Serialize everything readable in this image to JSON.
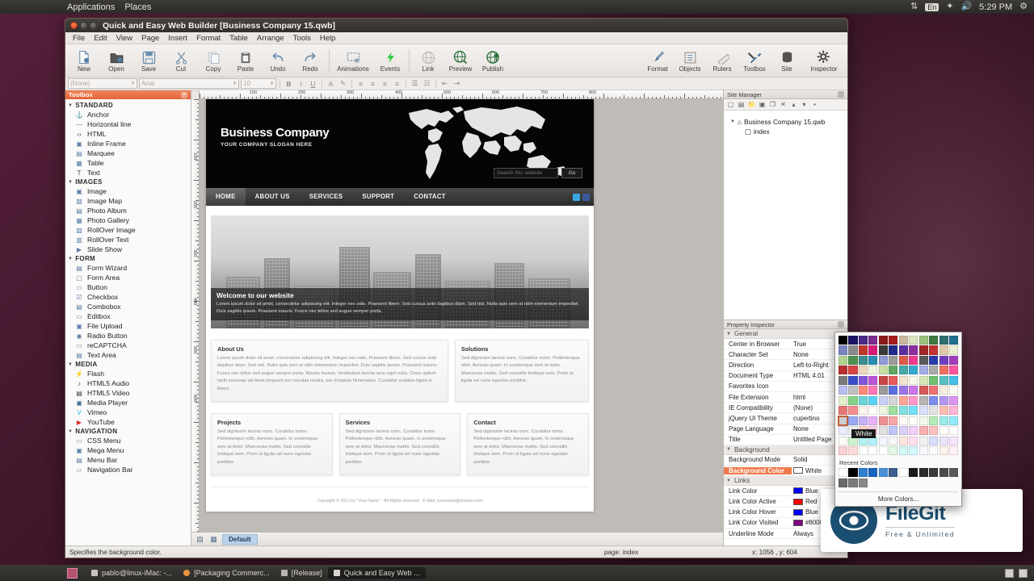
{
  "desktop": {
    "top_panel": {
      "menus": [
        "Applications",
        "Places"
      ],
      "clock": "5:29 PM",
      "indicators": [
        "network-icon",
        "keyboard-layout-en",
        "bluetooth-icon",
        "volume-icon",
        "system-settings-icon"
      ],
      "keyboard_layout": "En"
    },
    "taskbar": {
      "items": [
        {
          "label": "pablo@linux-iMac: -...",
          "color": "#c9c4be",
          "active": false
        },
        {
          "label": "[Packaging Commerc...",
          "color": "#e8953f",
          "active": false
        },
        {
          "label": "[Release]",
          "color": "#b8b3ad",
          "active": false
        },
        {
          "label": "Quick and Easy Web ...",
          "color": "#d8d3cd",
          "active": true
        }
      ]
    },
    "watermark": {
      "name": "FileGit",
      "tagline": "Free & Unlimited"
    }
  },
  "window": {
    "title": "Quick and Easy Web Builder [Business Company 15.qwb]",
    "menu": [
      "File",
      "Edit",
      "View",
      "Page",
      "Insert",
      "Format",
      "Table",
      "Arrange",
      "Tools",
      "Help"
    ]
  },
  "toolbar": {
    "left_buttons": [
      {
        "label": "New",
        "icon": "new-document-icon"
      },
      {
        "label": "Open",
        "icon": "open-folder-icon"
      },
      {
        "label": "Save",
        "icon": "floppy-disk-icon"
      },
      {
        "label": "Cut",
        "icon": "scissors-icon"
      },
      {
        "label": "Copy",
        "icon": "copy-icon"
      },
      {
        "label": "Paste",
        "icon": "clipboard-icon"
      },
      {
        "label": "Undo",
        "icon": "undo-arrow-icon"
      },
      {
        "label": "Redo",
        "icon": "redo-arrow-icon"
      },
      {
        "label": "Animations",
        "icon": "animation-icon"
      },
      {
        "label": "Events",
        "icon": "lightning-bolt-icon"
      },
      {
        "label": "Link",
        "icon": "globe-link-icon"
      },
      {
        "label": "Preview",
        "icon": "globe-search-icon"
      },
      {
        "label": "Publish",
        "icon": "globe-upload-icon"
      }
    ],
    "right_buttons": [
      {
        "label": "Format",
        "icon": "paintbrush-icon"
      },
      {
        "label": "Objects",
        "icon": "list-objects-icon"
      },
      {
        "label": "Rulers",
        "icon": "ruler-icon"
      },
      {
        "label": "Toolbox",
        "icon": "wrench-screwdriver-icon"
      },
      {
        "label": "Site",
        "icon": "database-icon"
      },
      {
        "label": "Inspector",
        "icon": "gear-icon"
      }
    ]
  },
  "fontbar": {
    "style_value": "(None)",
    "font_value": "Arial",
    "size_value": "10",
    "buttons": [
      "B",
      "I",
      "U"
    ]
  },
  "toolbox": {
    "caption": "Toolbox",
    "groups": [
      {
        "name": "STANDARD",
        "items": [
          {
            "label": "Anchor",
            "icon": "anchor-icon"
          },
          {
            "label": "Horizontal line",
            "icon": "horizontal-line-icon"
          },
          {
            "label": "HTML",
            "icon": "code-brackets-icon"
          },
          {
            "label": "Inline Frame",
            "icon": "inline-frame-icon"
          },
          {
            "label": "Marquee",
            "icon": "marquee-icon"
          },
          {
            "label": "Table",
            "icon": "table-icon"
          },
          {
            "label": "Text",
            "icon": "text-tool-icon"
          }
        ]
      },
      {
        "name": "IMAGES",
        "items": [
          {
            "label": "Image",
            "icon": "image-icon"
          },
          {
            "label": "Image Map",
            "icon": "image-map-icon"
          },
          {
            "label": "Photo Album",
            "icon": "photo-album-icon"
          },
          {
            "label": "Photo Gallery",
            "icon": "photo-gallery-icon"
          },
          {
            "label": "RollOver Image",
            "icon": "rollover-image-icon"
          },
          {
            "label": "RollOver Text",
            "icon": "rollover-text-icon"
          },
          {
            "label": "Slide Show",
            "icon": "slideshow-icon"
          }
        ]
      },
      {
        "name": "FORM",
        "items": [
          {
            "label": "Form Wizard",
            "icon": "form-wizard-icon"
          },
          {
            "label": "Form Area",
            "icon": "form-area-icon"
          },
          {
            "label": "Button",
            "icon": "button-icon"
          },
          {
            "label": "Checkbox",
            "icon": "checkbox-icon"
          },
          {
            "label": "Combobox",
            "icon": "combobox-icon"
          },
          {
            "label": "Editbox",
            "icon": "editbox-icon"
          },
          {
            "label": "File Upload",
            "icon": "file-upload-icon"
          },
          {
            "label": "Radio Button",
            "icon": "radio-button-icon"
          },
          {
            "label": "reCAPTCHA",
            "icon": "recaptcha-icon"
          },
          {
            "label": "Text Area",
            "icon": "textarea-icon"
          }
        ]
      },
      {
        "name": "MEDIA",
        "items": [
          {
            "label": "Flash",
            "icon": "flash-icon"
          },
          {
            "label": "HTML5 Audio",
            "icon": "audio-note-icon"
          },
          {
            "label": "HTML5 Video",
            "icon": "video-icon"
          },
          {
            "label": "Media Player",
            "icon": "media-player-icon"
          },
          {
            "label": "Vimeo",
            "icon": "vimeo-icon"
          },
          {
            "label": "YouTube",
            "icon": "youtube-icon"
          }
        ]
      },
      {
        "name": "NAVIGATION",
        "items": [
          {
            "label": "CSS Menu",
            "icon": "css-menu-icon"
          },
          {
            "label": "Mega Menu",
            "icon": "mega-menu-icon"
          },
          {
            "label": "Menu Bar",
            "icon": "menu-bar-icon"
          },
          {
            "label": "Navigation Bar",
            "icon": "navigation-bar-icon"
          }
        ]
      }
    ]
  },
  "ruler": {
    "h_labels": [
      "100",
      "200",
      "300",
      "400",
      "500",
      "600",
      "700",
      "800"
    ],
    "v_labels": [
      "100",
      "200",
      "300",
      "400",
      "500",
      "600"
    ]
  },
  "site_page": {
    "brand": "Business Company",
    "slogan": "YOUR COMPANY SLOGAN HERE",
    "search_placeholder": "Search this website",
    "search_button": "Go",
    "nav": [
      "HOME",
      "ABOUT US",
      "SERVICES",
      "SUPPORT",
      "CONTACT"
    ],
    "hero": {
      "title": "Welcome to our website",
      "text": "Lorem ipsum dolor sit amet, consectetur adipiscing elit. Integer nec odio. Praesent libero. Sed cursus ante dapibus diam. Sed nisi. Nulla quis sem at nibh elementum imperdiet. Duis sagittis ipsum. Praesent mauris. Fusce nec tellus sed augue semper porta."
    },
    "columns_top": [
      {
        "title": "About Us",
        "text": "Lorem ipsum dolor sit amet, consectetur adipiscing elit. Integer nec odio. Praesent libero. Sed cursus ante dapibus diam. Sed nisi. Nulla quis sem at nibh elementum imperdiet. Duis sagittis ipsum. Praesent mauris. Fusce nec tellus sed augue semper porta. Mauris massa. Vestibulum lacinia arcu eget nulla. Class aptent taciti sociosqu ad litora torquent per conubia nostra, per inceptos himenaeos. Curabitur sodales ligula in libero."
      },
      {
        "title": "Solutions",
        "text": "Sed dignissim lacinia nunc. Curabitur tortor. Pellentesque nibh. Aenean quam. In scelerisque sem at dolor. Maecenas mattis. Sed convallis tristique sem. Proin ut ligula vel nunc egestas porttitor."
      }
    ],
    "columns_bottom": [
      {
        "title": "Projects",
        "text": "Sed dignissim lacinia nunc. Curabitur tortor. Pellentesque nibh. Aenean quam. In scelerisque sem at dolor. Maecenas mattis. Sed convallis tristique sem. Proin ut ligula vel nunc egestas porttitor."
      },
      {
        "title": "Services",
        "text": "Sed dignissim lacinia nunc. Curabitur tortor. Pellentesque nibh. Aenean quam. In scelerisque sem at dolor. Maecenas mattis. Sed convallis tristique sem. Proin ut ligula vel nunc egestas porttitor."
      },
      {
        "title": "Contact",
        "text": "Sed dignissim lacinia nunc. Curabitur tortor. Pellentesque nibh. Aenean quam. In scelerisque sem at dolor. Maecenas mattis. Sed convallis tristique sem. Proin ut ligula vel nunc egestas porttitor."
      }
    ],
    "footer": "Copyright © 2013 by \"Your Name\"  -  All Rights reserved  -  E-Mail: yourname@domain.com"
  },
  "canvas_bar": {
    "tab_label": "Default"
  },
  "site_manager": {
    "caption": "Site Manager",
    "root": "Business Company 15.qwb",
    "child": "index"
  },
  "property_inspector": {
    "caption": "Property Inspector",
    "groups": [
      {
        "name": "General",
        "rows": [
          {
            "key": "Center in Browser",
            "value": "True"
          },
          {
            "key": "Character Set",
            "value": "None"
          },
          {
            "key": "Direction",
            "value": "Left-to-Right"
          },
          {
            "key": "Document Type",
            "value": "HTML 4.01"
          },
          {
            "key": "Favorites Icon",
            "value": ""
          },
          {
            "key": "File Extension",
            "value": "html"
          },
          {
            "key": "IE Compatibility",
            "value": "(None)"
          },
          {
            "key": "jQuery UI Theme",
            "value": "cupertino"
          },
          {
            "key": "Page Language",
            "value": "None"
          },
          {
            "key": "Title",
            "value": "Untitled Page"
          }
        ]
      },
      {
        "name": "Background",
        "rows": [
          {
            "key": "Background Mode",
            "value": "Solid"
          },
          {
            "key": "Background Color",
            "value": "White",
            "swatch": "#ffffff",
            "selected": true
          }
        ]
      },
      {
        "name": "Links",
        "rows": [
          {
            "key": "Link Color",
            "value": "Blue",
            "swatch": "#0000ff"
          },
          {
            "key": "Link Color Active",
            "value": "Red",
            "swatch": "#ff0000"
          },
          {
            "key": "Link Color Hover",
            "value": "Blue",
            "swatch": "#0000ff"
          },
          {
            "key": "Link Color Visited",
            "value": "#800080",
            "swatch": "#800080"
          },
          {
            "key": "Underline Mode",
            "value": "Always"
          }
        ]
      }
    ]
  },
  "color_picker": {
    "tooltip": "White",
    "recent_label": "Recent Colors",
    "more_label": "More Colors...",
    "selected_color": "#ffffff",
    "palette": [
      [
        "#000000",
        "#1b1464",
        "#4b2a8a",
        "#7b2d8e",
        "#8b1a1a",
        "#a61c1c",
        "#c9b9a0",
        "#d9e3c0",
        "#9ac27a",
        "#3f7a3f",
        "#2f6f6f",
        "#1f6f8f",
        "#7a86c0",
        "#8b8b8b",
        "#c0392b",
        "#d81b7a"
      ],
      [
        "#3a3a3a",
        "#1f2a8a",
        "#5b2fa0",
        "#8e2fa0",
        "#a12626",
        "#c33232",
        "#e0c9aa",
        "#e8f0cf",
        "#b3d48f",
        "#4f9050",
        "#3a8f8f",
        "#2a8fb5",
        "#8f9ad6",
        "#9a9a9a",
        "#e05a4a",
        "#f03a8e"
      ],
      [
        "#5a5a5a",
        "#2a3aa8",
        "#6f3fbf",
        "#a23fbf",
        "#b63030",
        "#d84444",
        "#ecd9c0",
        "#f0f5de",
        "#c6e0a4",
        "#5fa860",
        "#48a8a8",
        "#35a8d0",
        "#a3aee6",
        "#ababab",
        "#f07060",
        "#ff55a0"
      ],
      [
        "#7a7a7a",
        "#3a4ec8",
        "#8355d8",
        "#b955d8",
        "#c94444",
        "#e85a5a",
        "#f2e4d2",
        "#f6f9e9",
        "#d5e9b8",
        "#6fc070",
        "#56c0c0",
        "#44c0e8",
        "#b7c0ef",
        "#c0c0c0",
        "#ff8a78",
        "#ff77b5"
      ],
      [
        "#9a9a9a",
        "#5a6ee0",
        "#9b75e8",
        "#cb75e8",
        "#d85a5a",
        "#f07272",
        "#f7eee2",
        "#fbfcf2",
        "#e2f0cc",
        "#84d485",
        "#6ad4d4",
        "#58d4f5",
        "#c9d0f5",
        "#d4d4d4",
        "#ffa595",
        "#ff99c8"
      ],
      [
        "#b5b5b5",
        "#7a8cec",
        "#b396f0",
        "#db96f0",
        "#e67575",
        "#f58e8e",
        "#fbf5ee",
        "#fdfef8",
        "#ecf6de",
        "#9be09c",
        "#82e0e0",
        "#74e0fa",
        "#dae0f9",
        "#e2e2e2",
        "#ffbeb2",
        "#ffb6d8"
      ],
      [
        "#cccccc",
        "#9aa8f2",
        "#c7b2f5",
        "#e7b2f5",
        "#f09090",
        "#fba6a6",
        "#fdf9f4",
        "#fefffb",
        "#f4faeb",
        "#b4eab5",
        "#9aeaea",
        "#92eafc",
        "#e8ecfc",
        "#eeeeee",
        "#ffd3ca",
        "#ffcde5"
      ],
      [
        "#e0e0e0",
        "#bcc6f7",
        "#dcd0f9",
        "#f0d0f9",
        "#f7b0b0",
        "#fdc0c0",
        "#fefdfa",
        "#ffffff",
        "#fafdf5",
        "#cdf2ce",
        "#b4f2f2",
        "#b2f2fd",
        "#f2f4fe",
        "#f6f6f6",
        "#ffe4de",
        "#ffe0ef"
      ],
      [
        "#f2f2f2",
        "#d8def9",
        "#eae4fc",
        "#f7e4fc",
        "#fbd0d0",
        "#fedcdc",
        "#ffffff",
        "#ffffff",
        "#ffffff",
        "#e2f8e3",
        "#d2f8f8",
        "#d2f8fe",
        "#f8f9ff",
        "#fbfbfb",
        "#fff1ee",
        "#fff0f7"
      ]
    ],
    "recent": [
      "#ffffff",
      "#000000",
      "#2f7fd0",
      "#1565c0",
      "#4a90d9",
      "#3b5e8c",
      "#ffffff",
      "#1a1a1a",
      "#2b2b2b",
      "#3a3a3a",
      "#4a4a4a",
      "#5a5a5a",
      "#6a6a6a",
      "#7a7a7a",
      "#8a8a8a"
    ]
  },
  "statusbar": {
    "hint": "Specifies the background color.",
    "page": "page: index",
    "coords": "x: 1056 , y: 604"
  }
}
